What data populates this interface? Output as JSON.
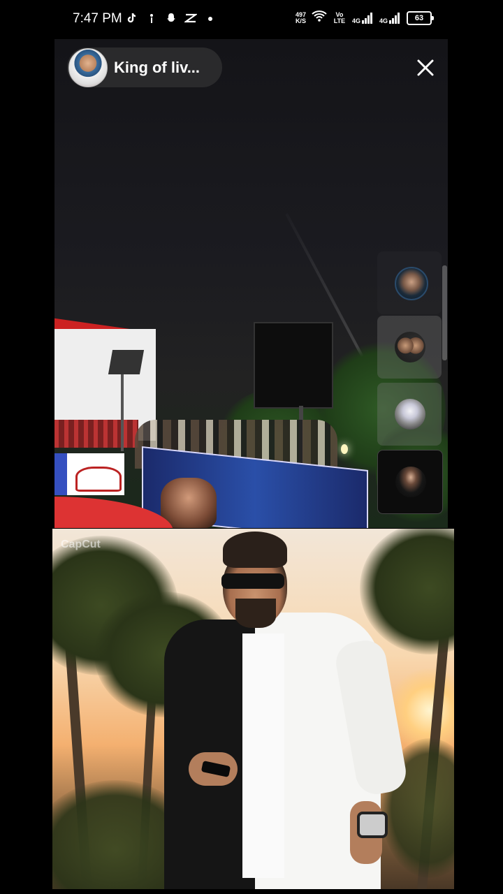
{
  "status_bar": {
    "time": "7:47 PM",
    "net_speed_value": "497",
    "net_speed_unit": "K/S",
    "volte": "Vo LTE",
    "network1": "4G",
    "network2": "4G",
    "battery": "63",
    "icons": [
      "tiktok-icon",
      "notification-icon",
      "snapchat-icon",
      "capcut-icon",
      "dot-icon",
      "wifi-icon",
      "signal-icon",
      "battery-icon"
    ]
  },
  "live": {
    "host_name": "King of liv...",
    "close_icon": "close-icon",
    "guest_avatars": [
      "guest-avatar-1",
      "guest-avatar-2",
      "guest-avatar-3",
      "guest-avatar-4"
    ]
  },
  "video": {
    "watermark": "CapCut"
  }
}
